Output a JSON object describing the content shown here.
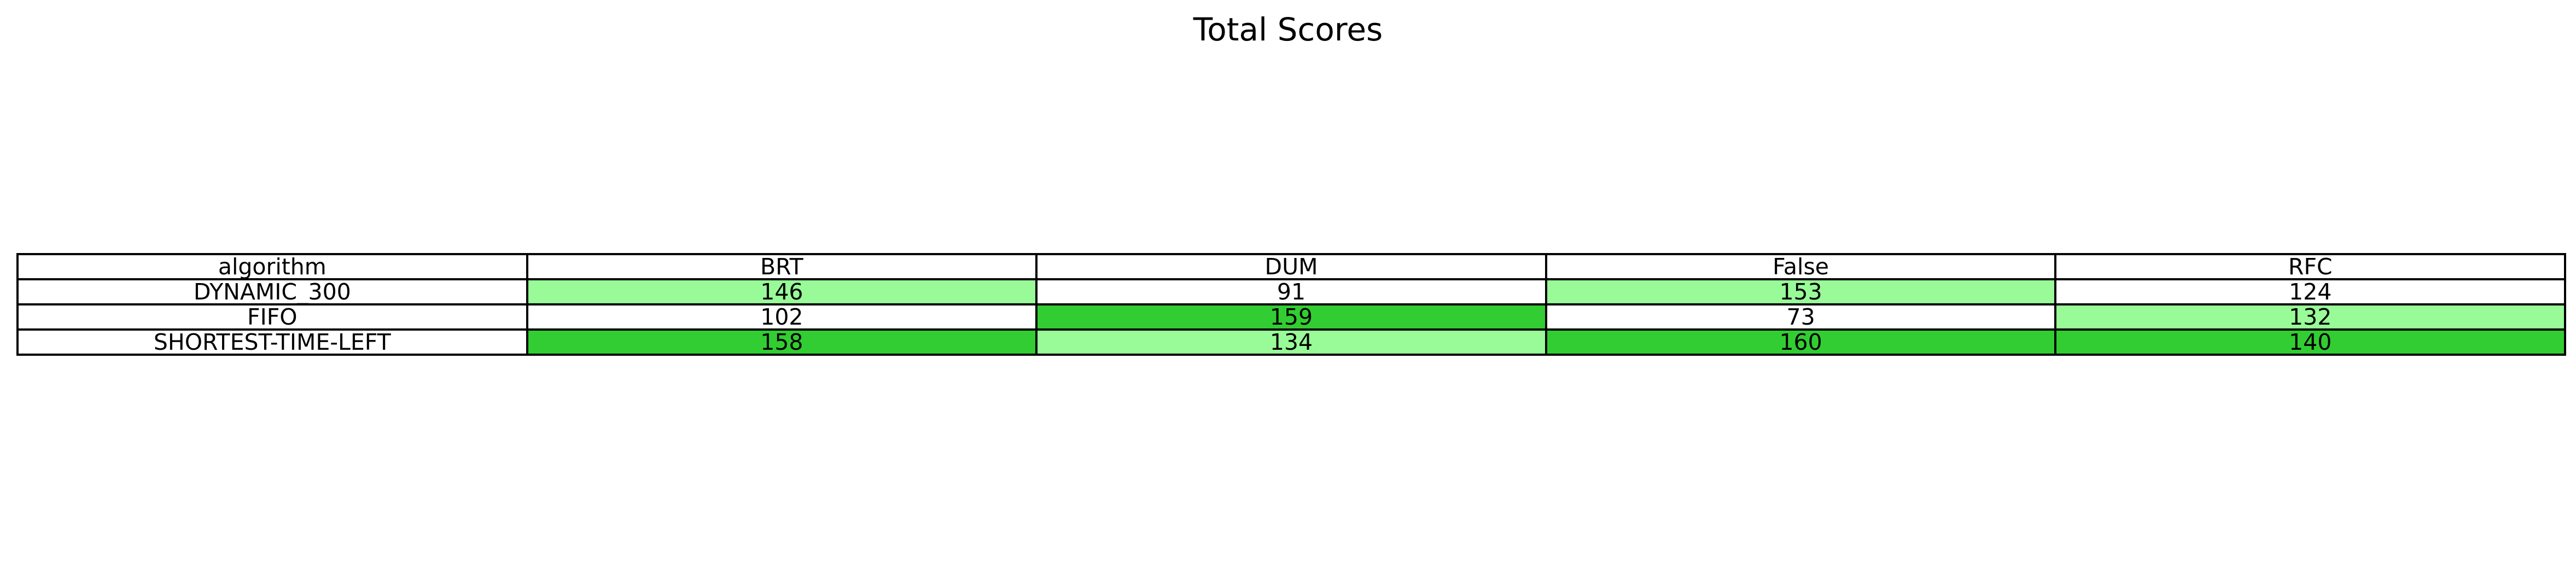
{
  "chart_data": {
    "type": "table",
    "title": "Total Scores",
    "columns": [
      "algorithm",
      "BRT",
      "DUM",
      "False",
      "RFC"
    ],
    "rows": [
      {
        "algorithm": "DYNAMIC_300",
        "values": [
          146,
          91,
          153,
          124
        ]
      },
      {
        "algorithm": "FIFO",
        "values": [
          102,
          159,
          73,
          132
        ]
      },
      {
        "algorithm": "SHORTEST-TIME-LEFT",
        "values": [
          158,
          134,
          160,
          140
        ]
      }
    ],
    "cell_colors": [
      [
        "#98fb98",
        "#ffffff",
        "#98fb98",
        "#ffffff"
      ],
      [
        "#ffffff",
        "#32cd32",
        "#ffffff",
        "#98fb98"
      ],
      [
        "#32cd32",
        "#98fb98",
        "#32cd32",
        "#32cd32"
      ]
    ],
    "colors": {
      "best": "#32cd32",
      "second": "#98fb98",
      "default": "#ffffff"
    }
  }
}
